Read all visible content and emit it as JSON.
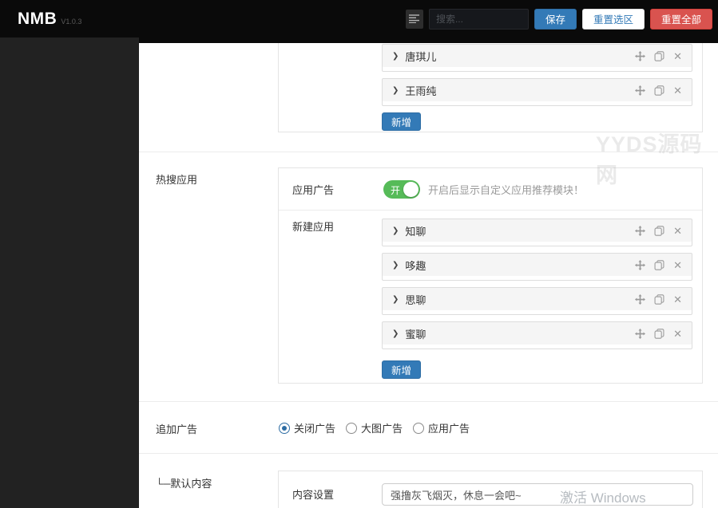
{
  "header": {
    "logo": "NMB",
    "version": "V1.0.3",
    "search_placeholder": "搜索...",
    "save_label": "保存",
    "reset_selection_label": "重置选区",
    "reset_all_label": "重置全部"
  },
  "icons": {
    "chevron": "❯",
    "close": "✕",
    "move": "move",
    "copy": "copy",
    "menu": "menu"
  },
  "colors": {
    "primary": "#337ab7",
    "danger": "#d9534f",
    "toggle_green": "#56bb58"
  },
  "top_panel": {
    "items": [
      {
        "name": "唐琪儿"
      },
      {
        "name": "王雨纯"
      }
    ],
    "add_label": "新增"
  },
  "hot_apps_section": {
    "label": "热搜应用",
    "app_ad_row": {
      "label": "应用广告",
      "toggle_on": true,
      "toggle_on_text": "开",
      "hint": "开启后显示自定义应用推荐模块！"
    },
    "new_app_row": {
      "label": "新建应用",
      "items": [
        {
          "name": "知聊"
        },
        {
          "name": "哆趣"
        },
        {
          "name": "思聊"
        },
        {
          "name": "蜜聊"
        }
      ],
      "add_label": "新增"
    }
  },
  "append_ad_section": {
    "label": "追加广告",
    "options": [
      {
        "label": "关闭广告",
        "selected": true
      },
      {
        "label": "大图广告",
        "selected": false
      },
      {
        "label": "应用广告",
        "selected": false
      }
    ]
  },
  "default_content_section": {
    "label": "└─默认内容",
    "content_row": {
      "label": "内容设置",
      "value": "强撸灰飞烟灭，休息一会吧~"
    }
  },
  "watermarks": {
    "site": "YYDS源码网",
    "windows": "激活 Windows"
  }
}
